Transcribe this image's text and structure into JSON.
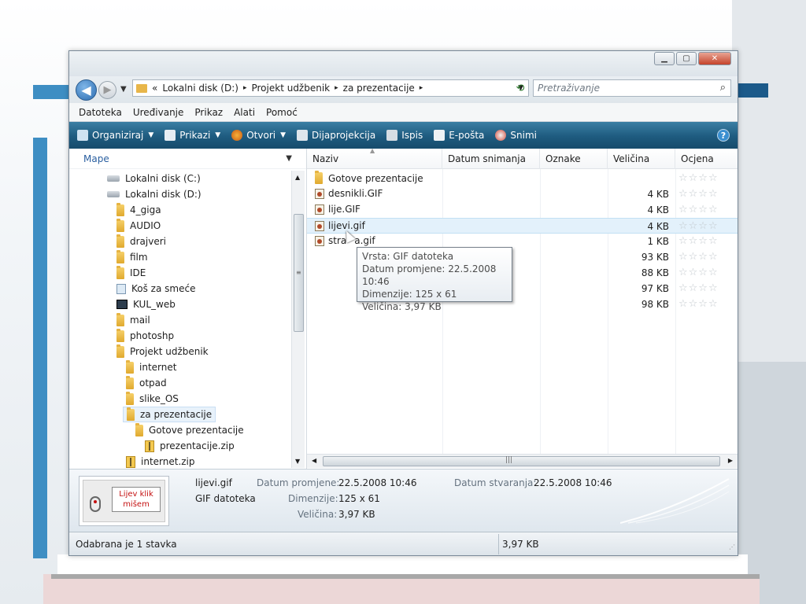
{
  "address_bar": {
    "breadcrumbs": [
      "Lokalni disk (D:)",
      "Projekt udžbenik",
      "za prezentacije"
    ],
    "prefix": "«",
    "separator": "▸",
    "search_placeholder": "Pretraživanje"
  },
  "menu": [
    "Datoteka",
    "Uređivanje",
    "Prikaz",
    "Alati",
    "Pomoć"
  ],
  "toolbar": {
    "organize": "Organiziraj",
    "views": "Prikazi",
    "open": "Otvori",
    "slideshow": "Dijaprojekcija",
    "print": "Ispis",
    "email": "E-pošta",
    "burn": "Snimi"
  },
  "nav_pane": {
    "header": "Mape",
    "items": [
      {
        "label": "Lokalni disk (C:)",
        "icon": "drive-icon",
        "indent": 0
      },
      {
        "label": "Lokalni disk (D:)",
        "icon": "drive-icon",
        "indent": 0
      },
      {
        "label": "4_giga",
        "icon": "folder-icon",
        "indent": 1
      },
      {
        "label": "AUDIO",
        "icon": "folder-icon",
        "indent": 1
      },
      {
        "label": "drajveri",
        "icon": "folder-icon",
        "indent": 1
      },
      {
        "label": "film",
        "icon": "folder-icon",
        "indent": 1
      },
      {
        "label": "IDE",
        "icon": "folder-icon",
        "indent": 1
      },
      {
        "label": "Koš za smeće",
        "icon": "recycle-bin-icon",
        "indent": 1
      },
      {
        "label": "KUL_web",
        "icon": "web-folder-icon",
        "indent": 1
      },
      {
        "label": "mail",
        "icon": "folder-icon",
        "indent": 1
      },
      {
        "label": "photoshp",
        "icon": "folder-icon",
        "indent": 1
      },
      {
        "label": "Projekt udžbenik",
        "icon": "folder-icon",
        "indent": 1
      },
      {
        "label": "internet",
        "icon": "folder-icon",
        "indent": 2
      },
      {
        "label": "otpad",
        "icon": "folder-icon",
        "indent": 2
      },
      {
        "label": "slike_OS",
        "icon": "folder-icon",
        "indent": 2
      },
      {
        "label": "za prezentacije",
        "icon": "folder-icon",
        "indent": 2,
        "selected": true
      },
      {
        "label": "Gotove prezentacije",
        "icon": "folder-icon",
        "indent": 3
      },
      {
        "label": "prezentacije.zip",
        "icon": "zip-icon",
        "indent": 4
      },
      {
        "label": "internet.zip",
        "icon": "zip-icon",
        "indent": 2
      }
    ]
  },
  "columns": [
    "Naziv",
    "Datum snimanja",
    "Oznake",
    "Veličina",
    "Ocjena"
  ],
  "files": [
    {
      "name": "Gotove prezentacije",
      "icon": "folder-icon",
      "size": ""
    },
    {
      "name": "desnikli.GIF",
      "icon": "gif-icon",
      "size": "4 KB"
    },
    {
      "name": "lije.GIF",
      "icon": "gif-icon",
      "size": "4 KB"
    },
    {
      "name": "lijevi.gif",
      "icon": "gif-icon",
      "size": "4 KB",
      "hover": true
    },
    {
      "name": "stra",
      "icon": "gif-icon",
      "size": "1 KB"
    }
  ],
  "extra_sizes": [
    "93 KB",
    "88 KB",
    "97 KB",
    "98 KB"
  ],
  "partial_name_tail": "a.gif",
  "stars": "☆☆☆☆",
  "tooltip": {
    "type": "Vrsta: GIF datoteka",
    "modified": "Datum promjene: 22.5.2008 10:46",
    "dimensions": "Dimenzije: 125 x 61",
    "size": "Veličina: 3,97 KB"
  },
  "details": {
    "filename": "lijevi.gif",
    "filetype": "GIF datoteka",
    "modified_label": "Datum promjene:",
    "modified_value": "22.5.2008 10:46",
    "dimensions_label": "Dimenzije:",
    "dimensions_value": "125 x 61",
    "size_label": "Veličina:",
    "size_value": "3,97 KB",
    "created_label": "Datum stvaranja:",
    "created_value": "22.5.2008 10:46",
    "thumbnail_text_1": "Lijev klik",
    "thumbnail_text_2": "mišem"
  },
  "status": {
    "selection": "Odabrana je 1 stavka",
    "size": "3,97 KB"
  },
  "colors": {
    "command_bar": "#1e5b7f",
    "selection": "#e8f2fb",
    "accent_blue": "#3e8ec3"
  }
}
